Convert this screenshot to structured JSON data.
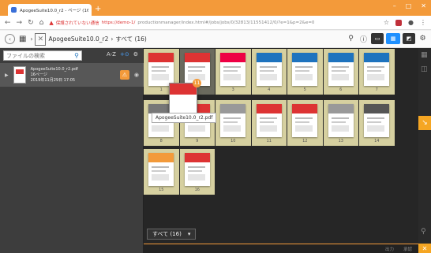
{
  "browser": {
    "tab_title": "ApogeeSuite10.0_r2 - ページ (16) ×",
    "address_warning": "保護されていない通信",
    "url_domain": "https://demo-1/",
    "url_path": "productionmanager/index.html#/jobs/jobs/0/32813/11551412/0/?e=1&p=2&e=0"
  },
  "toolbar": {
    "breadcrumb_job": "ApogeeSuite10.0_r2",
    "breadcrumb_pages": "すべて (16)"
  },
  "left_panel": {
    "search_placeholder": "ファイルの検索",
    "sort_label": "A-Z",
    "file": {
      "name": "ApogeeSuite10.0_r2.pdf",
      "pages": "16ページ",
      "date": "2019年11月29日 17:05"
    }
  },
  "main": {
    "drag_tooltip": "ApogeeSuite10.0_r2.pdf",
    "drag_badge": "11",
    "filter_label": "すべて (16)",
    "pages": [
      {
        "n": "1",
        "color": "#d33"
      },
      {
        "n": "2",
        "color": "#d33"
      },
      {
        "n": "3",
        "color": "#e04"
      },
      {
        "n": "4",
        "color": "#1e73be"
      },
      {
        "n": "5",
        "color": "#1e73be"
      },
      {
        "n": "6",
        "color": "#1e73be"
      },
      {
        "n": "7",
        "color": "#1e73be"
      },
      {
        "n": "8",
        "color": "#777"
      },
      {
        "n": "9",
        "color": "#d33"
      },
      {
        "n": "10",
        "color": "#999"
      },
      {
        "n": "11",
        "color": "#d33"
      },
      {
        "n": "12",
        "color": "#d33"
      },
      {
        "n": "13",
        "color": "#999"
      },
      {
        "n": "14",
        "color": "#555"
      },
      {
        "n": "15",
        "color": "#f39a3a"
      },
      {
        "n": "16",
        "color": "#d33"
      }
    ]
  },
  "bottom": {
    "action_1": "出力",
    "action_2": "承認"
  }
}
